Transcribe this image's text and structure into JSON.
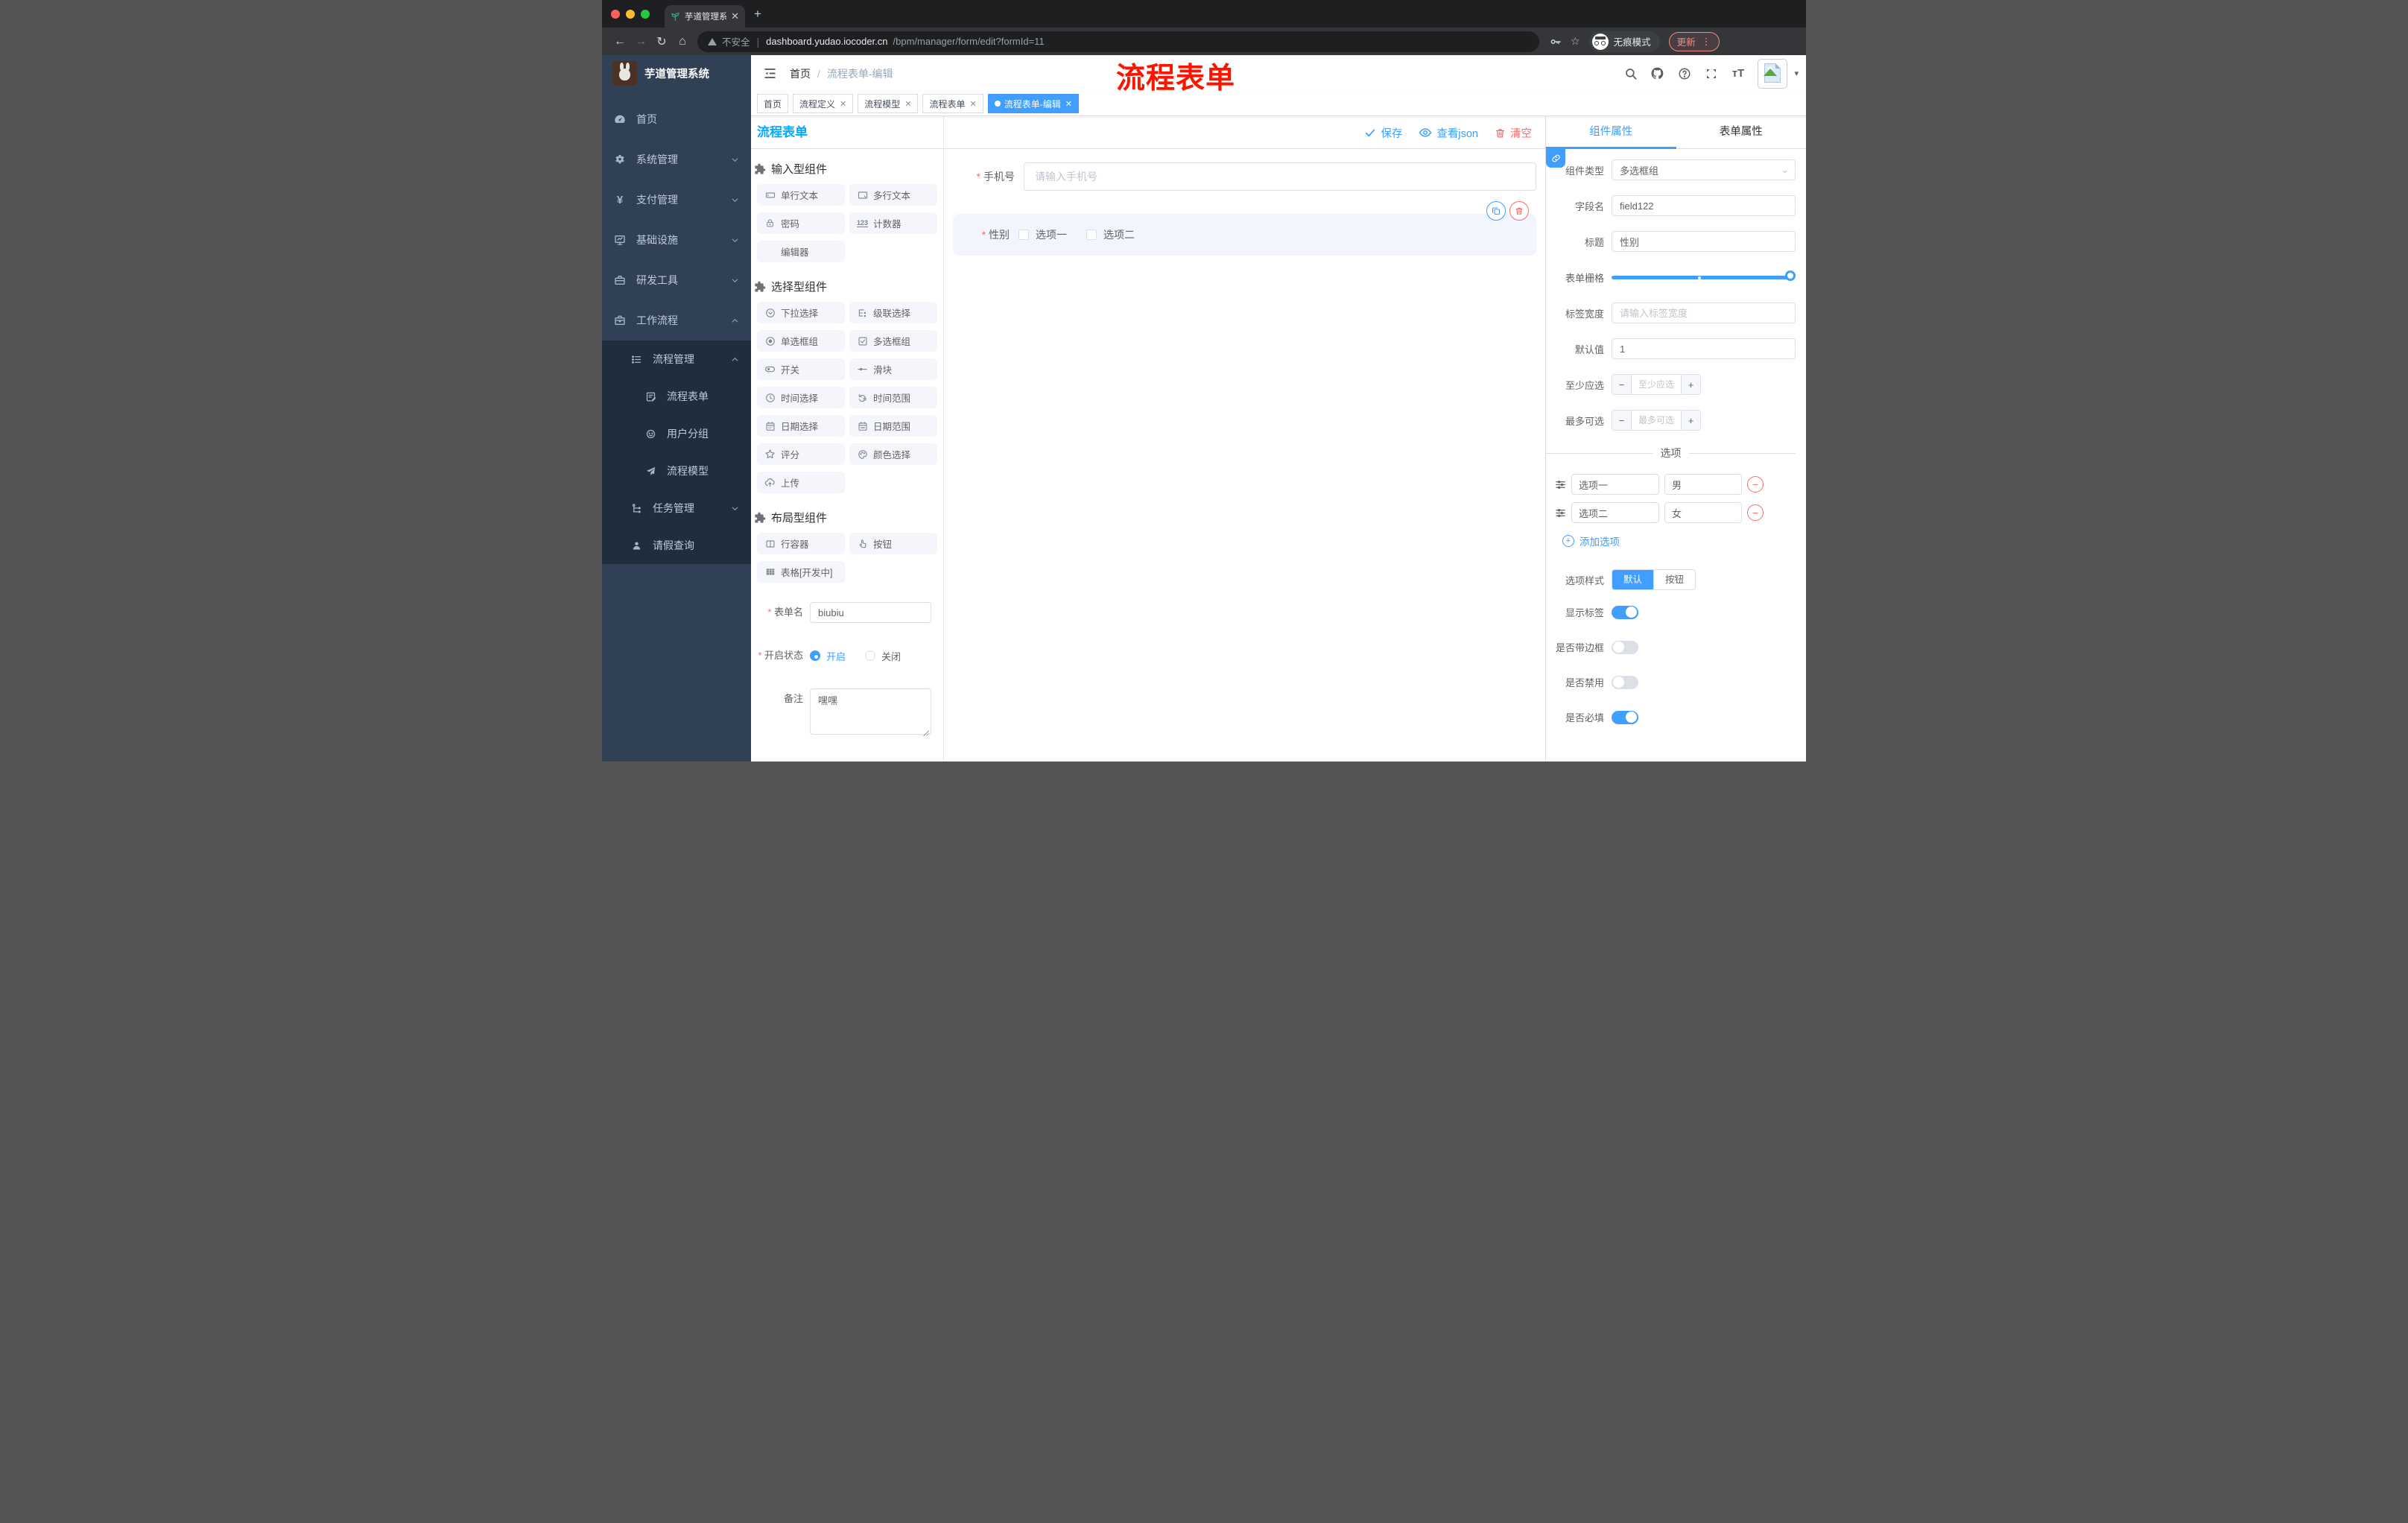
{
  "browser": {
    "tab_title": "芋道管理系统",
    "security_label": "不安全",
    "url_host": "dashboard.yudao.iocoder.cn",
    "url_path": "/bpm/manager/form/edit?formId=11",
    "incognito_label": "无痕模式",
    "update_label": "更新"
  },
  "annotation": "流程表单",
  "sidebar": {
    "app_title": "芋道管理系统",
    "menu": [
      {
        "label": "首页",
        "icon": "dashboard-icon"
      },
      {
        "label": "系统管理",
        "icon": "gear-icon"
      },
      {
        "label": "支付管理",
        "icon": "yen-icon"
      },
      {
        "label": "基础设施",
        "icon": "monitor-icon"
      },
      {
        "label": "研发工具",
        "icon": "toolbox-icon"
      },
      {
        "label": "工作流程",
        "icon": "briefcase-icon"
      }
    ],
    "submenu": [
      {
        "label": "流程管理"
      },
      {
        "label": "流程表单"
      },
      {
        "label": "用户分组"
      },
      {
        "label": "流程模型"
      },
      {
        "label": "任务管理"
      },
      {
        "label": "请假查询"
      }
    ]
  },
  "navbar": {
    "breadcrumb_home": "首页",
    "breadcrumb_current": "流程表单-编辑"
  },
  "tags": [
    {
      "label": "首页"
    },
    {
      "label": "流程定义"
    },
    {
      "label": "流程模型"
    },
    {
      "label": "流程表单"
    },
    {
      "label": "流程表单-编辑"
    }
  ],
  "page": {
    "title": "流程表单",
    "toolbar": {
      "save": "保存",
      "view_json": "查看json",
      "clear": "清空"
    }
  },
  "palette": {
    "sections": [
      {
        "title": "输入型组件",
        "items": [
          {
            "label": "单行文本"
          },
          {
            "label": "多行文本"
          },
          {
            "label": "密码"
          },
          {
            "label": "计数器",
            "icon_text": "123"
          },
          {
            "label": "编辑器"
          }
        ]
      },
      {
        "title": "选择型组件",
        "items": [
          {
            "label": "下拉选择"
          },
          {
            "label": "级联选择"
          },
          {
            "label": "单选框组"
          },
          {
            "label": "多选框组"
          },
          {
            "label": "开关"
          },
          {
            "label": "滑块"
          },
          {
            "label": "时间选择"
          },
          {
            "label": "时间范围"
          },
          {
            "label": "日期选择"
          },
          {
            "label": "日期范围"
          },
          {
            "label": "评分"
          },
          {
            "label": "颜色选择"
          },
          {
            "label": "上传"
          }
        ]
      },
      {
        "title": "布局型组件",
        "items": [
          {
            "label": "行容器"
          },
          {
            "label": "按钮"
          },
          {
            "label": "表格[开发中]"
          }
        ]
      }
    ]
  },
  "meta_form": {
    "form_name": {
      "label": "表单名",
      "value": "biubiu",
      "required": true
    },
    "status": {
      "label": "开启状态",
      "on_label": "开启",
      "off_label": "关闭",
      "selected": "开启",
      "required": true
    },
    "remark": {
      "label": "备注",
      "value": "嘿嘿"
    }
  },
  "canvas": {
    "phone": {
      "label": "手机号",
      "placeholder": "请输入手机号",
      "required": true
    },
    "gender": {
      "label": "性别",
      "required": true,
      "option1": "选项一",
      "option2": "选项二"
    }
  },
  "panel": {
    "tab_component": "组件属性",
    "tab_form": "表单属性",
    "component_type": {
      "label": "组件类型",
      "value": "多选框组"
    },
    "field_name": {
      "label": "字段名",
      "value": "field122"
    },
    "title": {
      "label": "标题",
      "value": "性别"
    },
    "form_grid": {
      "label": "表单栅格"
    },
    "label_width": {
      "label": "标签宽度",
      "placeholder": "请输入标签宽度"
    },
    "default_value": {
      "label": "默认值",
      "value": "1"
    },
    "min_select": {
      "label": "至少应选",
      "placeholder": "至少应选"
    },
    "max_select": {
      "label": "最多可选",
      "placeholder": "最多可选"
    },
    "options": {
      "divider": "选项",
      "rows": [
        {
          "name": "选项一",
          "value": "男"
        },
        {
          "name": "选项二",
          "value": "女"
        }
      ],
      "add_label": "添加选项"
    },
    "option_style": {
      "label": "选项样式",
      "default": "默认",
      "button": "按钮",
      "selected": "默认"
    },
    "switches": [
      {
        "label": "显示标签",
        "on": true
      },
      {
        "label": "是否带边框",
        "on": false
      },
      {
        "label": "是否禁用",
        "on": false
      },
      {
        "label": "是否必填",
        "on": true
      }
    ]
  },
  "colors": {
    "primary": "#409eff",
    "danger": "#f56c6c",
    "title_blue": "#00aaff",
    "sidebar_bg": "#304156",
    "submenu_bg": "#1f2d3d",
    "annotation_red": "#fd1400"
  }
}
